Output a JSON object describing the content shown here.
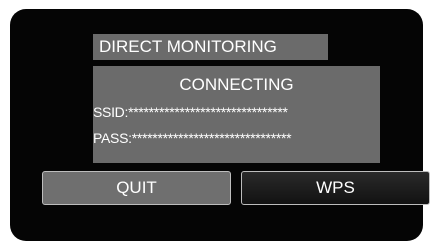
{
  "header": {
    "title": "DIRECT MONITORING"
  },
  "status": {
    "title": "CONNECTING",
    "ssid_line": "SSID:*******************************",
    "pass_line": "PASS:*******************************"
  },
  "buttons": {
    "quit_label": "QUIT",
    "wps_label": "WPS"
  },
  "colors": {
    "panel_background": "#050505",
    "box_gray": "#6b6b6b",
    "text": "#ffffff",
    "quit_button": "#6f6f6f",
    "wps_button": "#1e1e1e"
  }
}
